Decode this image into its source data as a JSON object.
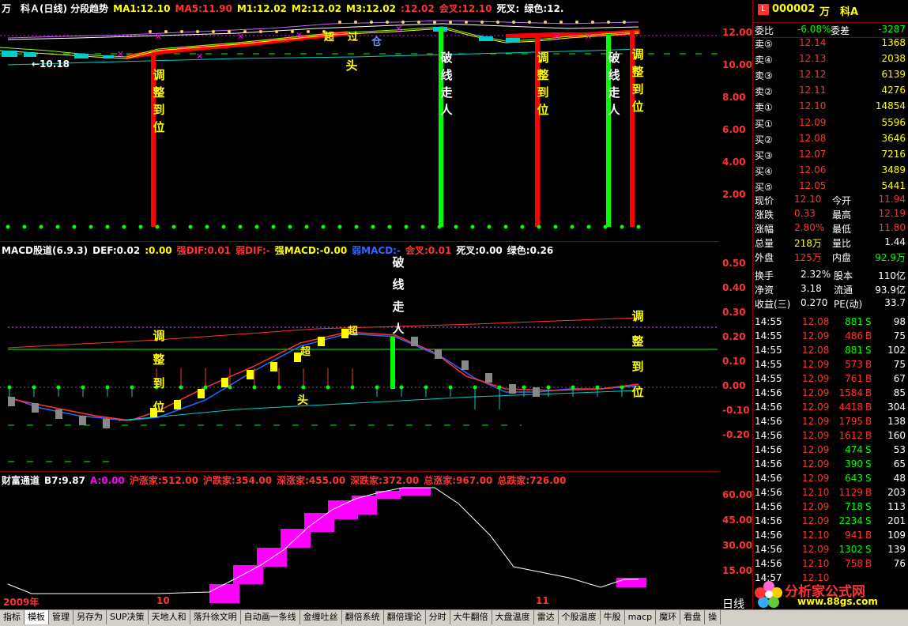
{
  "main_panel": {
    "header": [
      "万　科Ａ(日线) 分段趋势",
      "MA1:12.10",
      "MA5:11.90",
      "M1:12.02",
      "M2:12.02",
      "M3:12.02",
      ":12.02",
      "会叉:12.10",
      "死叉:",
      "绿色:12."
    ],
    "header_colors": [
      "#ffffff",
      "#ffff00",
      "#ff3333",
      "#ffff00",
      "#ffff00",
      "#ffff00",
      "#ff3333",
      "#ff3333",
      "#ffffff",
      "#ffffff"
    ],
    "axis": [
      "12.00",
      "10.00",
      "8.00",
      "6.00",
      "4.00",
      "2.00"
    ],
    "low_label": "←10.18",
    "labels": {
      "tiao": "调整到位",
      "po": "破线走人",
      "tou": "头",
      "chao": "超",
      "guo": "过",
      "cang": "仓"
    }
  },
  "macd_panel": {
    "header": [
      "MACD股道(6.9.3)",
      "DEF:0.02",
      ":0.00",
      "强DIF:0.01",
      "弱DIF:-",
      "强MACD:-0.00",
      "弱MACD:-",
      "会叉:0.01",
      "死叉:0.00",
      "绿色:0.26"
    ],
    "header_colors": [
      "#ffffff",
      "#ffffff",
      "#ffff00",
      "#ff3333",
      "#ff3333",
      "#ffff00",
      "#3366ff",
      "#ff3333",
      "#ffffff",
      "#ffffff"
    ],
    "axis": [
      "0.50",
      "0.40",
      "0.30",
      "0.20",
      "0.10",
      "0.00",
      "-0.10",
      "-0.20"
    ],
    "labels": {
      "tiao": "调整到位",
      "po": "破线走人",
      "tou": "头",
      "chao": "超",
      "chao2": "超"
    }
  },
  "wealth_panel": {
    "header": [
      "财富通道",
      "B7:9.87",
      "A:0.00",
      "沪涨家:512.00",
      "沪跌家:354.00",
      "深涨家:455.00",
      "深跌家:372.00",
      "总涨家:967.00",
      "总跌家:726.00"
    ],
    "header_colors": [
      "#ffffff",
      "#ffffff",
      "#ff00ff",
      "#ff3333",
      "#ff3333",
      "#ff3333",
      "#ff3333",
      "#ff3333",
      "#ff3333"
    ],
    "axis": [
      "60.00",
      "45.00",
      "30.00",
      "15.00"
    ],
    "x_labels": {
      "year": "2009年",
      "m10": "10",
      "m11": "11"
    }
  },
  "stock": {
    "code": "000002",
    "name": "万　科A",
    "weibi_label": "委比",
    "weibi": "-6.08%",
    "weicha_label": "委差",
    "weicha": "-3287",
    "sell": [
      {
        "label": "卖⑤",
        "price": "12.14",
        "vol": "1368"
      },
      {
        "label": "卖④",
        "price": "12.13",
        "vol": "2038"
      },
      {
        "label": "卖③",
        "price": "12.12",
        "vol": "6139"
      },
      {
        "label": "卖②",
        "price": "12.11",
        "vol": "4276"
      },
      {
        "label": "卖①",
        "price": "12.10",
        "vol": "14854"
      }
    ],
    "buy": [
      {
        "label": "买①",
        "price": "12.09",
        "vol": "5596"
      },
      {
        "label": "买②",
        "price": "12.08",
        "vol": "3646"
      },
      {
        "label": "买③",
        "price": "12.07",
        "vol": "7216"
      },
      {
        "label": "买④",
        "price": "12.06",
        "vol": "3489"
      },
      {
        "label": "买⑤",
        "price": "12.05",
        "vol": "5441"
      }
    ],
    "quote": [
      {
        "l1": "现价",
        "v1": "12.10",
        "c1": "#ff3333",
        "l2": "今开",
        "v2": "11.94",
        "c2": "#ff3333"
      },
      {
        "l1": "涨跌",
        "v1": "0.33",
        "c1": "#ff3333",
        "l2": "最高",
        "v2": "12.19",
        "c2": "#ff3333"
      },
      {
        "l1": "涨幅",
        "v1": "2.80%",
        "c1": "#ff3333",
        "l2": "最低",
        "v2": "11.80",
        "c2": "#ff3333"
      },
      {
        "l1": "总量",
        "v1": "218万",
        "c1": "#ffff00",
        "l2": "量比",
        "v2": "1.44",
        "c2": "#ffffff"
      },
      {
        "l1": "外盘",
        "v1": "125万",
        "c1": "#ff3333",
        "l2": "内盘",
        "v2": "92.9万",
        "c2": "#00ff00"
      }
    ],
    "stats": [
      {
        "l1": "换手",
        "v1": "2.32%",
        "l2": "股本",
        "v2": "110亿"
      },
      {
        "l1": "净资",
        "v1": "3.18",
        "l2": "流通",
        "v2": "93.9亿"
      },
      {
        "l1": "收益(三)",
        "v1": "0.270",
        "l2": "PE(动)",
        "v2": "33.7"
      }
    ],
    "ticks": [
      {
        "t": "14:55",
        "p": "12.08",
        "v": "881",
        "bs": "S",
        "n": "98"
      },
      {
        "t": "14:55",
        "p": "12.09",
        "v": "486",
        "bs": "B",
        "n": "75"
      },
      {
        "t": "14:55",
        "p": "12.08",
        "v": "881",
        "bs": "S",
        "n": "102"
      },
      {
        "t": "14:55",
        "p": "12.09",
        "v": "573",
        "bs": "B",
        "n": "75"
      },
      {
        "t": "14:55",
        "p": "12.09",
        "v": "761",
        "bs": "B",
        "n": "67"
      },
      {
        "t": "14:56",
        "p": "12.09",
        "v": "1584",
        "bs": "B",
        "n": "85"
      },
      {
        "t": "14:56",
        "p": "12.09",
        "v": "4418",
        "bs": "B",
        "n": "304"
      },
      {
        "t": "14:56",
        "p": "12.09",
        "v": "1795",
        "bs": "B",
        "n": "138"
      },
      {
        "t": "14:56",
        "p": "12.09",
        "v": "1612",
        "bs": "B",
        "n": "160"
      },
      {
        "t": "14:56",
        "p": "12.09",
        "v": "474",
        "bs": "S",
        "n": "53"
      },
      {
        "t": "14:56",
        "p": "12.09",
        "v": "390",
        "bs": "S",
        "n": "65"
      },
      {
        "t": "14:56",
        "p": "12.09",
        "v": "643",
        "bs": "S",
        "n": "48"
      },
      {
        "t": "14:56",
        "p": "12.10",
        "v": "1129",
        "bs": "B",
        "n": "203"
      },
      {
        "t": "14:56",
        "p": "12.09",
        "v": "718",
        "bs": "S",
        "n": "113"
      },
      {
        "t": "14:56",
        "p": "12.09",
        "v": "2234",
        "bs": "S",
        "n": "201"
      },
      {
        "t": "14:56",
        "p": "12.10",
        "v": "941",
        "bs": "B",
        "n": "109"
      },
      {
        "t": "14:56",
        "p": "12.09",
        "v": "1302",
        "bs": "S",
        "n": "139"
      },
      {
        "t": "14:56",
        "p": "12.10",
        "v": "758",
        "bs": "B",
        "n": "76"
      },
      {
        "t": "14:57",
        "p": "12.10",
        "v": "",
        "bs": "",
        "n": ""
      }
    ],
    "period_label": "日线",
    "logo_text": "分析家公式网",
    "logo_url": "www.88gs.com"
  },
  "tabs": [
    "指标",
    "模板",
    "管理",
    "另存为",
    "SUP决策",
    "天地人和",
    "落升徐文明",
    "自动画一条线",
    "金缠吐丝",
    "翻倍系统",
    "翻倍理论",
    "分时",
    "大牛翻倍",
    "大盘温度",
    "雷达",
    "个股温度",
    "牛股",
    "macp",
    "魔环",
    "看盘",
    "操"
  ],
  "active_tab": 1
}
